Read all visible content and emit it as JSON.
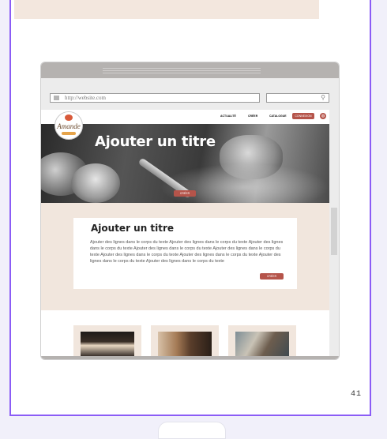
{
  "slide": {
    "page_number": "41"
  },
  "browser": {
    "url": "http://website.com",
    "search_placeholder": ""
  },
  "site": {
    "logo_text": "Amande",
    "nav": [
      "ACTUALITÉ",
      "CRÉER",
      "CATALOGUE"
    ],
    "connexion_label": "CONNEXION",
    "cart_icon": "cart-icon",
    "hero": {
      "title": "Ajouter un titre",
      "button_label": "CRÉER"
    },
    "content": {
      "title": "Ajouter un titre",
      "body": "Ajouter des lignes dans le corps du texte Ajouter des lignes dans le corps du texte Ajouter des lignes dans le corps du texte Ajouter des lignes dans le corps du texte Ajouter des lignes dans le corps du texte Ajouter des lignes dans le corps du texte Ajouter des lignes dans le corps du texte Ajouter des lignes dans le corps du texte Ajouter des lignes dans le corps du texte",
      "button_label": "CRÉER"
    }
  },
  "colors": {
    "accent": "#b5544a",
    "section_bg": "#f1e6dd",
    "frame_border": "#8b5cf6"
  }
}
